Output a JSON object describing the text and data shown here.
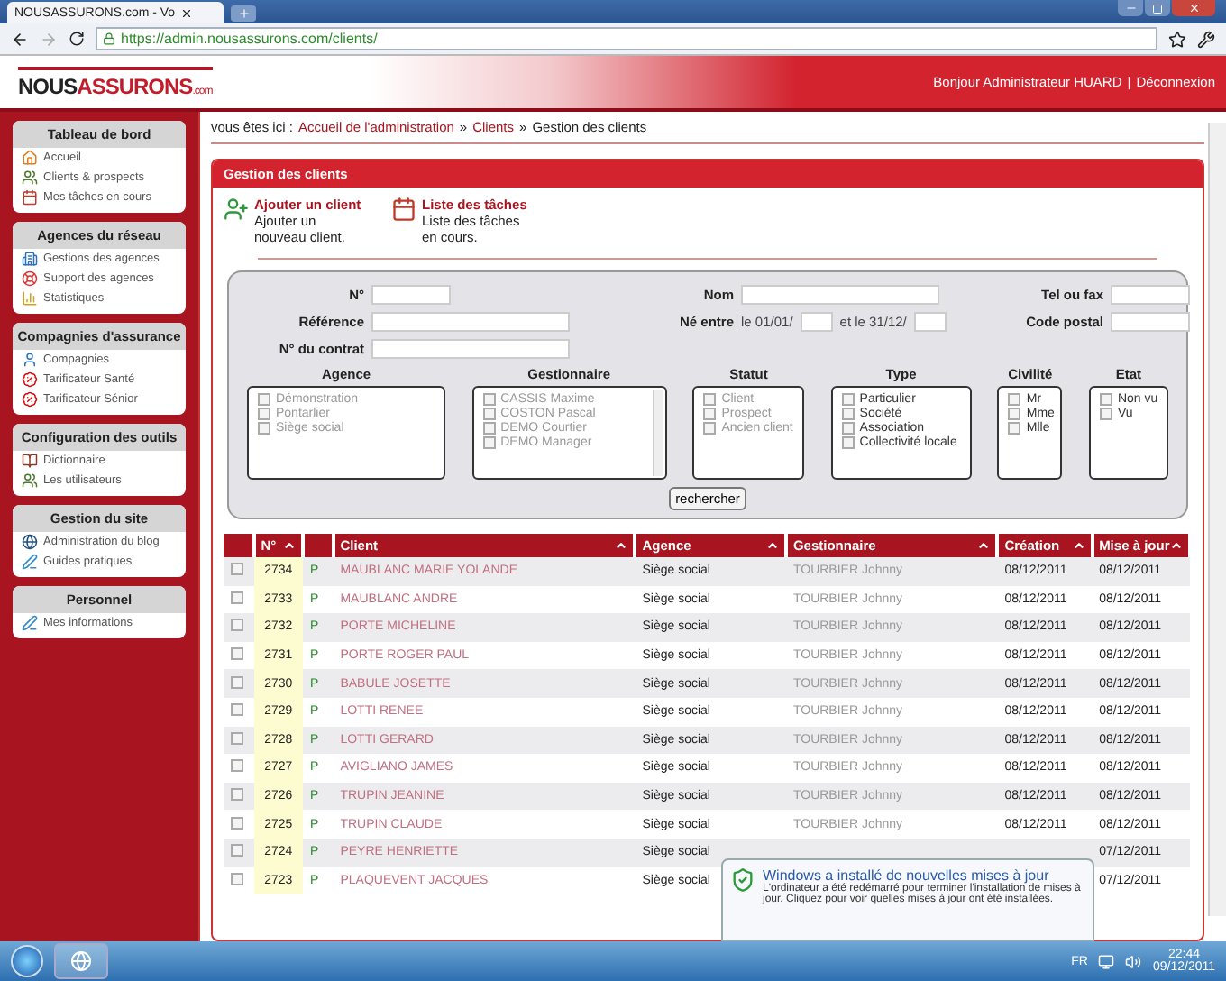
{
  "browser": {
    "tab_title": "NOUSASSURONS.com - Vo",
    "url": "https://admin.nousassurons.com/clients/"
  },
  "header": {
    "logo": [
      "NOUS",
      "ASSURONS",
      ".com"
    ],
    "greeting": "Bonjour Administrateur HUARD",
    "separator": "|",
    "logout": "Déconnexion"
  },
  "sidebar": [
    {
      "title": "Tableau de bord",
      "items": [
        {
          "label": "Accueil"
        },
        {
          "label": "Clients & prospects"
        },
        {
          "label": "Mes tâches en cours"
        }
      ]
    },
    {
      "title": "Agences du réseau",
      "items": [
        {
          "label": "Gestions des agences"
        },
        {
          "label": "Support des agences"
        },
        {
          "label": "Statistiques"
        }
      ]
    },
    {
      "title": "Compagnies d'assurance",
      "items": [
        {
          "label": "Compagnies"
        },
        {
          "label": "Tarificateur Santé"
        },
        {
          "label": "Tarificateur Sénior"
        }
      ]
    },
    {
      "title": "Configuration des outils",
      "items": [
        {
          "label": "Dictionnaire"
        },
        {
          "label": "Les utilisateurs"
        }
      ]
    },
    {
      "title": "Gestion du site",
      "items": [
        {
          "label": "Administration du blog"
        },
        {
          "label": "Guides pratiques"
        }
      ]
    },
    {
      "title": "Personnel",
      "items": [
        {
          "label": "Mes informations"
        }
      ]
    }
  ],
  "breadcrumb": {
    "prefix": "vous êtes ici :",
    "links": [
      "Accueil de l'administration",
      "Clients"
    ],
    "separator": "»",
    "current": "Gestion des clients"
  },
  "panel": {
    "title": "Gestion des clients",
    "actions": [
      {
        "title": "Ajouter un client",
        "description": "Ajouter un nouveau client."
      },
      {
        "title": "Liste des tâches",
        "description": "Liste des tâches en cours."
      }
    ],
    "search": {
      "columns": [
        [
          {
            "label": "N°",
            "kind": "text"
          },
          {
            "label": "Référence",
            "kind": "text"
          },
          {
            "label": "N° du contrat",
            "kind": "text"
          }
        ],
        [
          {
            "label": "Nom",
            "kind": "text"
          },
          {
            "label": "Né entre",
            "kind": "dates",
            "parts": [
              "le 01/01/",
              "et le 31/12/"
            ]
          }
        ],
        [
          {
            "label": "Tel ou fax",
            "kind": "text"
          },
          {
            "label": "Code postal",
            "kind": "text"
          }
        ]
      ],
      "groups": [
        {
          "title": "Agence",
          "scroll": false,
          "options": [
            {
              "label": "Démonstration",
              "checked": false
            },
            {
              "label": "Pontarlier",
              "checked": false
            },
            {
              "label": "Siège social",
              "checked": false
            }
          ]
        },
        {
          "title": "Gestionnaire",
          "scroll": true,
          "options": [
            {
              "label": "CASSIS Maxime",
              "checked": false
            },
            {
              "label": "COSTON Pascal",
              "checked": false
            },
            {
              "label": "DEMO Courtier",
              "checked": false
            },
            {
              "label": "DEMO Manager",
              "checked": false
            }
          ]
        },
        {
          "title": "Statut",
          "scroll": false,
          "options": [
            {
              "label": "Client",
              "checked": false
            },
            {
              "label": "Prospect",
              "checked": false
            },
            {
              "label": "Ancien client",
              "checked": false
            }
          ]
        },
        {
          "title": "Type",
          "scroll": false,
          "options": [
            {
              "label": "Particulier",
              "checked": false
            },
            {
              "label": "Société",
              "checked": false
            },
            {
              "label": "Association",
              "checked": false
            },
            {
              "label": "Collectivité locale",
              "checked": false
            }
          ]
        },
        {
          "title": "Civilité",
          "scroll": false,
          "options": [
            {
              "label": "Mr",
              "checked": false
            },
            {
              "label": "Mme",
              "checked": false
            },
            {
              "label": "Mlle",
              "checked": false
            }
          ]
        },
        {
          "title": "Etat",
          "scroll": false,
          "options": [
            {
              "label": "Non vu",
              "checked": false
            },
            {
              "label": "Vu",
              "checked": false
            }
          ]
        }
      ],
      "button": "rechercher"
    }
  },
  "table": {
    "columns": [
      {
        "kind": "check"
      },
      {
        "kind": "sort",
        "label": "N°"
      },
      {
        "kind": "blank"
      },
      {
        "kind": "sort",
        "label": "Client"
      },
      {
        "kind": "sort",
        "label": "Agence"
      },
      {
        "kind": "sort",
        "label": "Gestionnaire"
      },
      {
        "kind": "sort",
        "label": "Création"
      },
      {
        "kind": "sort",
        "label": "Mise à jour"
      }
    ],
    "rows": [
      {
        "checked": false,
        "number": "2734",
        "status": "P",
        "client": "MAUBLANC MARIE YOLANDE",
        "agence": "Siège social",
        "gestionnaire": "TOURBIER Johnny",
        "creation": "08/12/2011",
        "maj": "08/12/2011"
      },
      {
        "checked": false,
        "number": "2733",
        "status": "P",
        "client": "MAUBLANC ANDRE",
        "agence": "Siège social",
        "gestionnaire": "TOURBIER Johnny",
        "creation": "08/12/2011",
        "maj": "08/12/2011"
      },
      {
        "checked": false,
        "number": "2732",
        "status": "P",
        "client": "PORTE MICHELINE",
        "agence": "Siège social",
        "gestionnaire": "TOURBIER Johnny",
        "creation": "08/12/2011",
        "maj": "08/12/2011"
      },
      {
        "checked": false,
        "number": "2731",
        "status": "P",
        "client": "PORTE ROGER PAUL",
        "agence": "Siège social",
        "gestionnaire": "TOURBIER Johnny",
        "creation": "08/12/2011",
        "maj": "08/12/2011"
      },
      {
        "checked": false,
        "number": "2730",
        "status": "P",
        "client": "BABULE JOSETTE",
        "agence": "Siège social",
        "gestionnaire": "TOURBIER Johnny",
        "creation": "08/12/2011",
        "maj": "08/12/2011"
      },
      {
        "checked": false,
        "number": "2729",
        "status": "P",
        "client": "LOTTI RENEE",
        "agence": "Siège social",
        "gestionnaire": "TOURBIER Johnny",
        "creation": "08/12/2011",
        "maj": "08/12/2011"
      },
      {
        "checked": false,
        "number": "2728",
        "status": "P",
        "client": "LOTTI GERARD",
        "agence": "Siège social",
        "gestionnaire": "TOURBIER Johnny",
        "creation": "08/12/2011",
        "maj": "08/12/2011"
      },
      {
        "checked": false,
        "number": "2727",
        "status": "P",
        "client": "AVIGLIANO JAMES",
        "agence": "Siège social",
        "gestionnaire": "TOURBIER Johnny",
        "creation": "08/12/2011",
        "maj": "08/12/2011"
      },
      {
        "checked": false,
        "number": "2726",
        "status": "P",
        "client": "TRUPIN JEANINE",
        "agence": "Siège social",
        "gestionnaire": "TOURBIER Johnny",
        "creation": "08/12/2011",
        "maj": "08/12/2011"
      },
      {
        "checked": false,
        "number": "2725",
        "status": "P",
        "client": "TRUPIN CLAUDE",
        "agence": "Siège social",
        "gestionnaire": "TOURBIER Johnny",
        "creation": "08/12/2011",
        "maj": "08/12/2011"
      },
      {
        "checked": false,
        "number": "2724",
        "status": "P",
        "client": "PEYRE HENRIETTE",
        "agence": "Siège social",
        "maj": "07/12/2011"
      },
      {
        "checked": false,
        "number": "2723",
        "status": "P",
        "client": "PLAQUEVENT JACQUES",
        "agence": "Siège social",
        "maj": "07/12/2011"
      }
    ]
  },
  "notification": {
    "title": "Windows a installé de nouvelles mises à jour",
    "body": "L'ordinateur a été redémarré pour terminer l'installation de mises à jour. Cliquez pour voir quelles mises à jour ont été installées."
  },
  "taskbar": {
    "language": "FR",
    "time": "22:44",
    "date": "09/12/2011"
  }
}
